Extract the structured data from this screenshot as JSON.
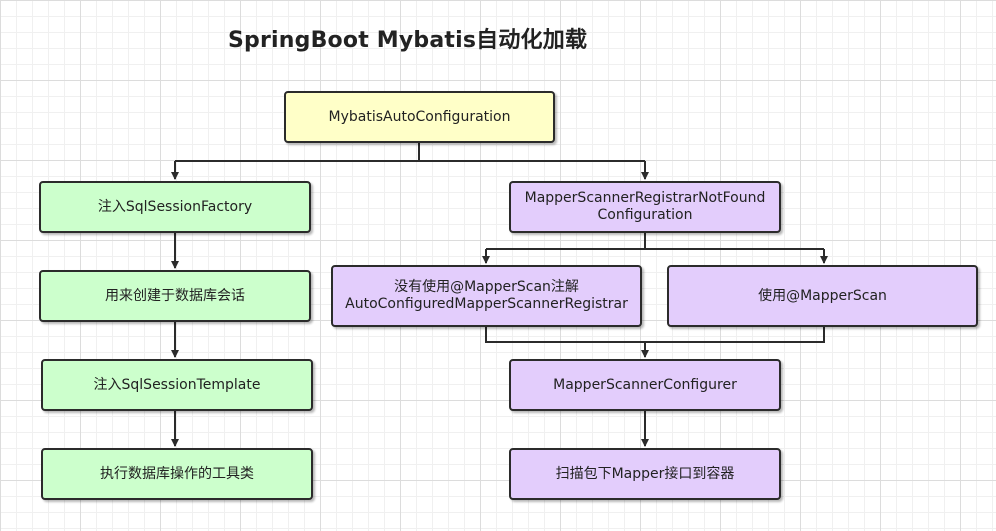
{
  "title": "SpringBoot Mybatis自动化加载",
  "nodes": {
    "root": "MybatisAutoConfiguration",
    "inject_factory": "注入SqlSessionFactory",
    "create_session": "用来创建于数据库会话",
    "inject_template": "注入SqlSessionTemplate",
    "tool_class": "执行数据库操作的工具类",
    "not_found_config": [
      "MapperScannerRegistrarNotFound",
      "Configuration"
    ],
    "no_mapper_scan": [
      "没有使用@MapperScan注解",
      "AutoConfiguredMapperScannerRegistrar"
    ],
    "use_mapper_scan": "使用@MapperScan",
    "configurer": "MapperScannerConfigurer",
    "scan_package": "扫描包下Mapper接口到容器"
  },
  "colors": {
    "yellow_fill": "#ffffc8",
    "green_fill": "#ccffcc",
    "purple_fill": "#e3cdfc",
    "stroke": "#2b2b2b"
  }
}
